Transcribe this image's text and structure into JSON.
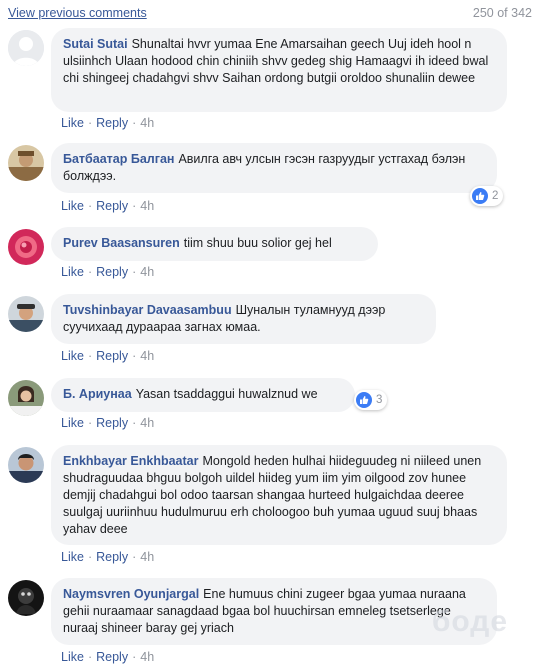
{
  "header": {
    "view_previous": "View previous comments",
    "count": "250 of 342"
  },
  "actions": {
    "like": "Like",
    "reply": "Reply",
    "separator": "·"
  },
  "watermark": "боде",
  "comments": [
    {
      "author": "Sutai Sutai",
      "text": "Shunaltai hvvr yumaa Ene Amarsaihan geech Uuj ideh hool n ulsiinhch Ulaan hodood chin chiniih shvv gedeg shig Hamaagvi ih ideed bwal chi shingeej chadahgvi shvv Saihan ordong butgii oroldoo shunaliin dewee",
      "time": "4h"
    },
    {
      "author": "Батбаатар Балган",
      "text": "Авилга авч улсын гэсэн газруудыг устгахад бэлэн болждээ.",
      "time": "4h",
      "reactions": "2"
    },
    {
      "author": "Purev Baasansuren",
      "text": "tiim shuu buu solior gej hel",
      "time": "4h"
    },
    {
      "author": "Tuvshinbayar Davaasambuu",
      "text": "Шуналын туламнууд дээр суучихаад дураараа загнах юмаа.",
      "time": "4h"
    },
    {
      "author": "Б. Ариунаа",
      "text": "Yasan tsaddaggui huwalznud we",
      "time": "4h",
      "reactions": "3"
    },
    {
      "author": "Enkhbayar Enkhbaatar",
      "text": "Mongold heden hulhai hiideguudeg ni niileed unen shudraguudaa bhguu bolgoh uildel hiideg yum iim yim oilgood zov hunee demjij chadahgui bol odoo taarsan shangaa hurteed hulgaichdaa deeree suulgaj uuriinhuu hudulmuruu erh choloogoo buh yumaa uguud suuj bhaas yahav deee",
      "time": "4h"
    },
    {
      "author": "Naymsvren Oyunjargal",
      "text": "Ene humuus chini zugeer bgaa yumaa nuraana gehii nuraamaar sanagdaad bgaa bol huuchirsan emneleg tsetserlege nuraaj shineer baray gej yriach",
      "time": "4h"
    }
  ]
}
